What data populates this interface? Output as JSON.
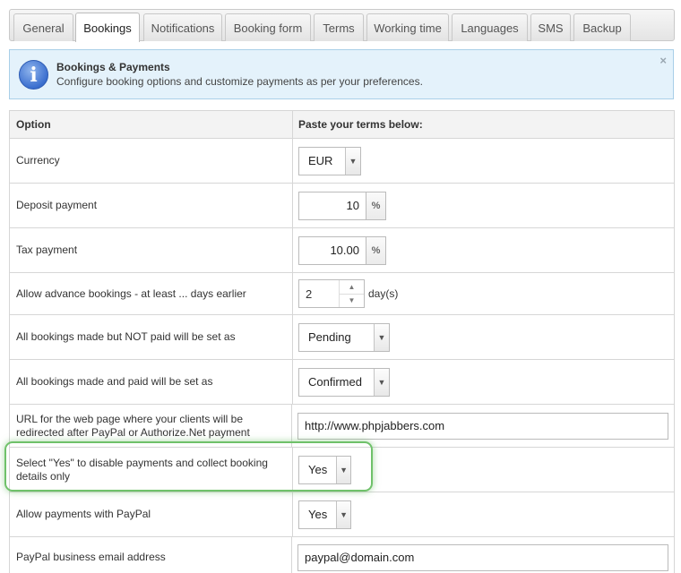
{
  "tabs": [
    {
      "label": "General",
      "active": false
    },
    {
      "label": "Bookings",
      "active": true
    },
    {
      "label": "Notifications",
      "active": false
    },
    {
      "label": "Booking form",
      "active": false
    },
    {
      "label": "Terms",
      "active": false
    },
    {
      "label": "Working time",
      "active": false
    },
    {
      "label": "Languages",
      "active": false
    },
    {
      "label": "SMS",
      "active": false
    },
    {
      "label": "Backup",
      "active": false
    }
  ],
  "info": {
    "title": "Bookings & Payments",
    "text": "Configure booking options and customize payments as per your preferences.",
    "close": "×"
  },
  "table": {
    "header": {
      "option": "Option",
      "value": "Paste your terms below:"
    },
    "rows": {
      "currency": {
        "label": "Currency",
        "value": "EUR"
      },
      "deposit": {
        "label": "Deposit payment",
        "value": "10",
        "unit": "%"
      },
      "tax": {
        "label": "Tax payment",
        "value": "10.00",
        "unit": "%"
      },
      "advance": {
        "label": "Allow advance bookings - at least ... days earlier",
        "value": "2",
        "unit": "day(s)"
      },
      "not_paid": {
        "label": "All bookings made but NOT paid will be set as",
        "value": "Pending"
      },
      "paid": {
        "label": "All bookings made and paid will be set as",
        "value": "Confirmed"
      },
      "redirect_url": {
        "label": "URL for the web page where your clients will be redirected after PayPal or Authorize.Net payment",
        "value": "http://www.phpjabbers.com"
      },
      "disable_payments": {
        "label": "Select \"Yes\" to disable payments and collect booking details only",
        "value": "Yes"
      },
      "paypal": {
        "label": "Allow payments with PayPal",
        "value": "Yes"
      },
      "paypal_email": {
        "label": "PayPal business email address",
        "value": "paypal@domain.com"
      }
    }
  },
  "icons": {
    "arrow": "▼",
    "spin_up": "▲",
    "spin_down": "▼",
    "info": "i"
  },
  "colors": {
    "info_bg": "#e4f2fb",
    "highlight": "#6fc16a"
  }
}
